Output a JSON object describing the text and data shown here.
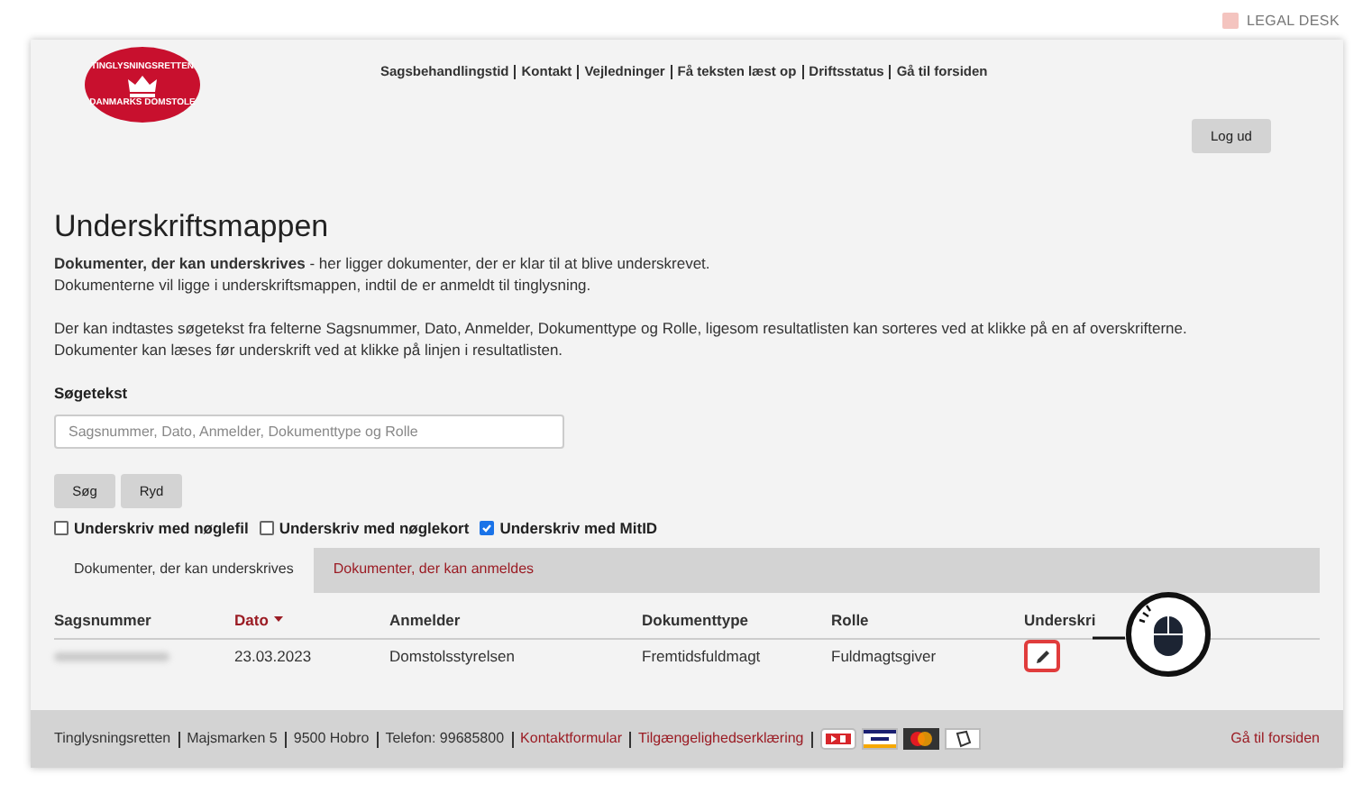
{
  "brand": {
    "name": "LEGAL DESK"
  },
  "logo": {
    "top_text": "TINGLYSNINGSRETTEN",
    "bottom_text": "DANMARKS DOMSTOLE"
  },
  "nav": [
    "Sagsbehandlingstid",
    "Kontakt",
    "Vejledninger",
    "Få teksten læst op",
    "Driftsstatus",
    "Gå til forsiden"
  ],
  "logout_button": "Log ud",
  "title": "Underskriftsmappen",
  "paragraphs": [
    "**Dokumenter, der kan underskrives** - her ligger dokumenter, der er klar til at blive underskrevet.",
    "Dokumenterne vil ligge i underskriftsmappen, indtil de er anmeldt til tinglysning.",
    "Der kan indtastes søgetekst fra felterne Sagsnummer, Dato, Anmelder, Dokumenttype og Rolle, ligesom resultatlisten kan sorteres ved at klikke på en af overskrifterne.",
    "Dokumenter kan læses før underskrift ved at klikke på linjen i resultatlisten."
  ],
  "search": {
    "label": "Søgetekst",
    "placeholder": "Sagsnummer, Dato, Anmelder, Dokumenttype og Rolle"
  },
  "buttons": [
    "Søg",
    "Ryd"
  ],
  "sign_options": [
    {
      "label": "Underskriv med nøglefil",
      "checked": false
    },
    {
      "label": "Underskriv med nøglekort",
      "checked": false
    },
    {
      "label": "Underskriv med MitID",
      "checked": true
    }
  ],
  "tabs": [
    {
      "label": "Dokumenter, der kan underskrives",
      "selected": true
    },
    {
      "label": "Dokumenter, der kan anmeldes",
      "selected": false
    }
  ],
  "table": {
    "columns": [
      {
        "label": "Sagsnummer",
        "sorted": false
      },
      {
        "label": "Dato",
        "sorted": true
      },
      {
        "label": "Anmelder",
        "sorted": false
      },
      {
        "label": "Dokumenttype",
        "sorted": false
      },
      {
        "label": "Rolle",
        "sorted": false
      },
      {
        "label": "Underskri",
        "sorted": false
      }
    ],
    "rows": [
      {
        "blurred": true,
        "cells": [
          "",
          "23.03.2023",
          "Domstolsstyrelsen",
          "Fremtidsfuldmagt",
          "Fuldmagtsgiver"
        ]
      }
    ]
  },
  "footer": {
    "items": [
      {
        "text": "Tinglysningsretten",
        "kind": "text"
      },
      {
        "text": "Majsmarken 5",
        "kind": "text"
      },
      {
        "text": "9500 Hobro",
        "kind": "text"
      },
      {
        "text": "Telefon: 99685800",
        "kind": "text"
      },
      {
        "text": "Kontaktformular",
        "kind": "link"
      },
      {
        "text": "Tilgængelighedserklæring",
        "kind": "link"
      }
    ],
    "home_link": "Gå til forsiden"
  }
}
